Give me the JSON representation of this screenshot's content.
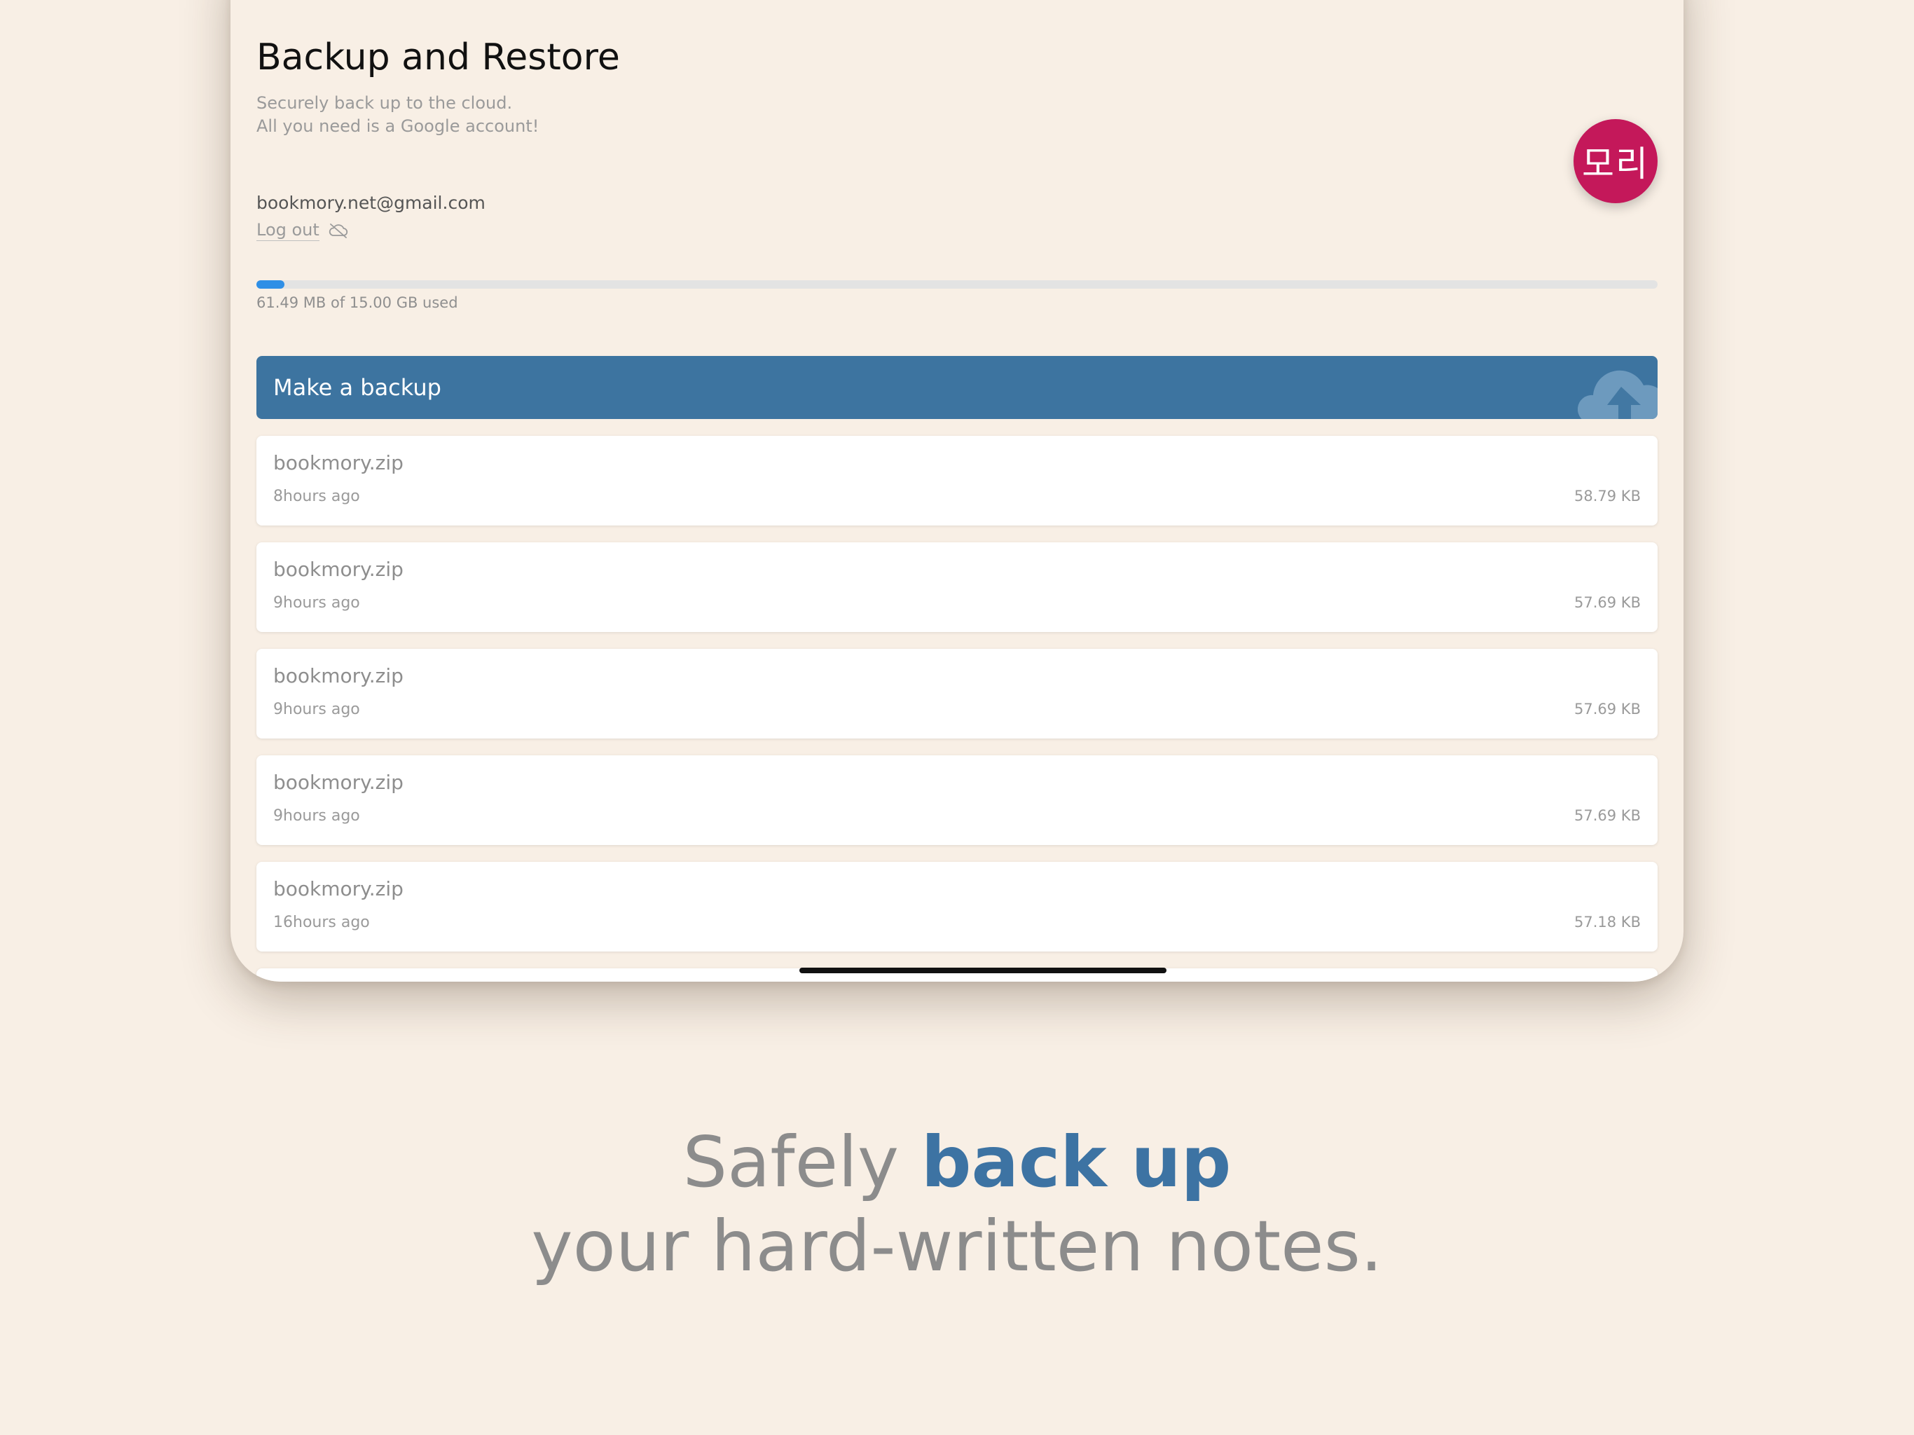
{
  "header": {
    "title": "Backup and Restore",
    "subtitle_line1": "Securely back up to the cloud.",
    "subtitle_line2": "All you need is a Google account!"
  },
  "account": {
    "email": "bookmory.net@gmail.com",
    "logout_label": "Log out",
    "logout_icon": "cloud-off-icon",
    "avatar_text": "모리",
    "avatar_color": "#c4185a"
  },
  "storage": {
    "used_fraction": 0.004,
    "text": "61.49 MB of 15.00 GB used",
    "bar_color": "#2f8fe6"
  },
  "backup_button": {
    "label": "Make a backup",
    "icon": "cloud-upload-icon",
    "color": "#3d74a0"
  },
  "backups": [
    {
      "name": "bookmory.zip",
      "time": "8hours ago",
      "size": "58.79 KB"
    },
    {
      "name": "bookmory.zip",
      "time": "9hours ago",
      "size": "57.69 KB"
    },
    {
      "name": "bookmory.zip",
      "time": "9hours ago",
      "size": "57.69 KB"
    },
    {
      "name": "bookmory.zip",
      "time": "9hours ago",
      "size": "57.69 KB"
    },
    {
      "name": "bookmory.zip",
      "time": "16hours ago",
      "size": "57.18 KB"
    }
  ],
  "caption": {
    "line1_prefix": "Safely ",
    "line1_accent": "back up",
    "line2": "your hard-written notes.",
    "accent_color": "#3d73a3"
  }
}
